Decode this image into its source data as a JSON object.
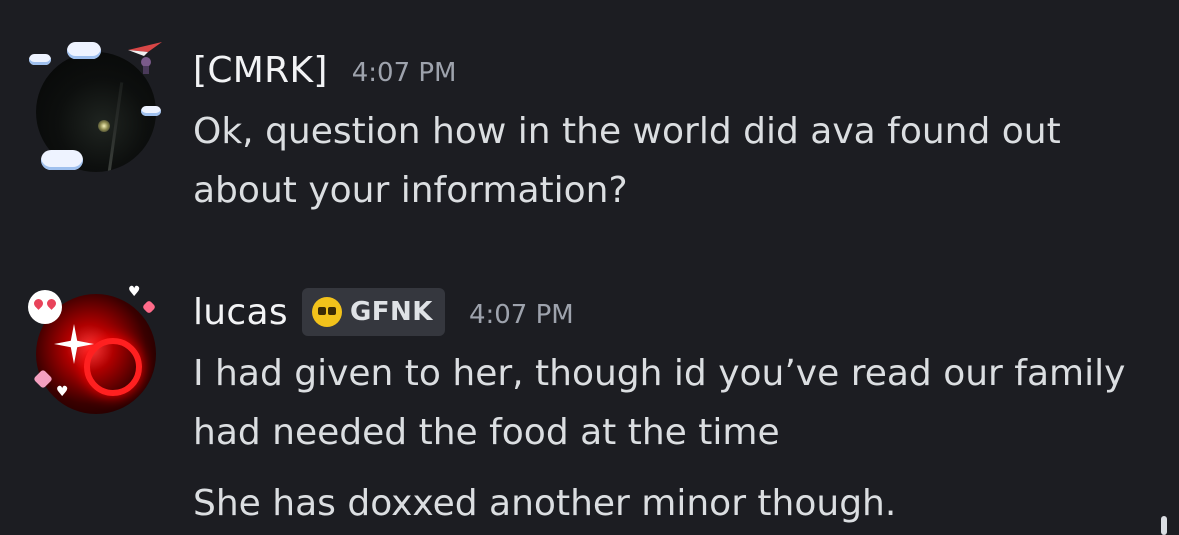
{
  "messages": [
    {
      "username": "[CMRK]",
      "timestamp": "4:07 PM",
      "text": "Ok, question how in the world did ava found out\nabout your information?"
    },
    {
      "username": "lucas",
      "tag": {
        "icon": "skull-icon",
        "label": "GFNK"
      },
      "timestamp": "4:07 PM",
      "text": "I had given to her, though id you’ve read our family\nhad needed the food at the time",
      "text2": "She has doxxed another minor though."
    }
  ],
  "colors": {
    "background": "#1c1d22",
    "username": "#f2f3f5",
    "message_text": "#dbdee1",
    "timestamp": "#9ea3ad",
    "tag_background": "#35373e",
    "tag_icon": "#f2c21b"
  }
}
